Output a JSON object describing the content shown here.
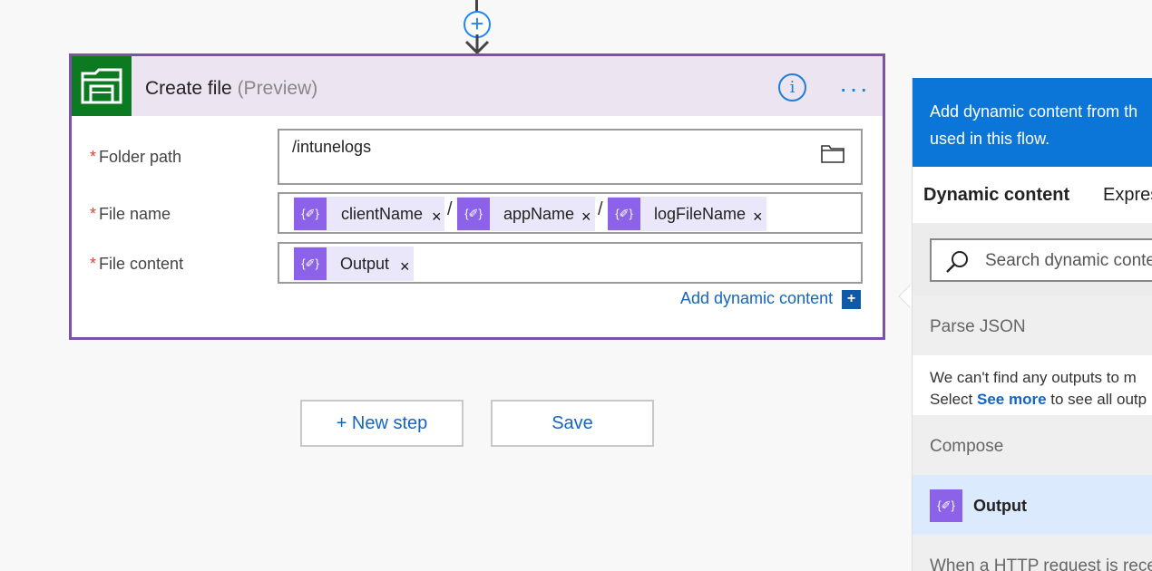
{
  "card": {
    "title": "Create file",
    "title_suffix": "(Preview)",
    "info_glyph": "i",
    "more_glyph": "···",
    "fields": {
      "folder_label": "Folder path",
      "folder_value": "/intunelogs",
      "file_name_label": "File name",
      "file_content_label": "File content",
      "required_mark": "*"
    },
    "tokens": {
      "client_name": "clientName",
      "app_name": "appName",
      "log_file_name": "logFileName",
      "output": "Output",
      "separator": "/",
      "close_glyph": "×",
      "token_glyph": "{✐}"
    },
    "add_dynamic_label": "Add dynamic content",
    "add_dynamic_glyph": "+"
  },
  "actions": {
    "new_step_label": "+ New step",
    "save_label": "Save"
  },
  "connector": {
    "plus_glyph": "+"
  },
  "panel": {
    "header_line1": "Add dynamic content from th",
    "header_line2": "used in this flow.",
    "tab_dynamic": "Dynamic content",
    "tab_expression": "Expres",
    "search_placeholder": "Search dynamic conte",
    "sections": {
      "parse_json_title": "Parse JSON",
      "parse_json_msg1": "We can't find any outputs to m",
      "parse_json_msg2_pre": "Select ",
      "parse_json_msg2_link": "See more",
      "parse_json_msg2_post": " to see all outp",
      "compose_title": "Compose",
      "compose_item": "Output",
      "http_title": "When a HTTP request is rece"
    }
  },
  "colors": {
    "accent": "#1565c0",
    "card_border": "#7e50a6",
    "card_header": "#ece4f1",
    "icon_green": "#0c7a20",
    "token_purple": "#8c63e8",
    "panel_blue": "#0b75d8"
  },
  "icons": {
    "card_icon": "file-explorer-icon",
    "folder_picker": "folder-icon",
    "search": "search-icon",
    "info": "info-icon",
    "more": "more-options-icon"
  }
}
